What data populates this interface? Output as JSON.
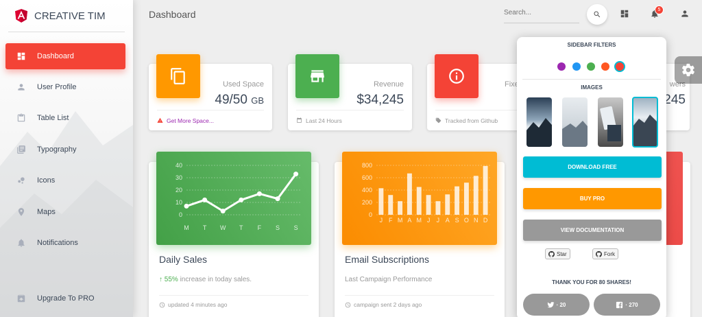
{
  "brand": {
    "name": "CREATIVE TIM"
  },
  "sidebar": {
    "items": [
      {
        "label": "Dashboard",
        "icon": "dashboard-icon"
      },
      {
        "label": "User Profile",
        "icon": "person-icon"
      },
      {
        "label": "Table List",
        "icon": "clipboard-icon"
      },
      {
        "label": "Typography",
        "icon": "library-books-icon"
      },
      {
        "label": "Icons",
        "icon": "bubble-chart-icon"
      },
      {
        "label": "Maps",
        "icon": "location-pin-icon"
      },
      {
        "label": "Notifications",
        "icon": "bell-icon"
      }
    ],
    "upgrade": "Upgrade To PRO"
  },
  "header": {
    "title": "Dashboard",
    "search_placeholder": "Search...",
    "notification_count": "5"
  },
  "stats": [
    {
      "category": "Used Space",
      "value": "49/50",
      "unit": "GB",
      "footer": "Get More Space...",
      "color": "#ff9800"
    },
    {
      "category": "Revenue",
      "value": "$34,245",
      "footer": "Last 24 Hours",
      "color": "#4caf50"
    },
    {
      "category": "Fixe",
      "value": "",
      "footer": "Tracked from Github",
      "color": "#f44336"
    },
    {
      "category": "wers",
      "value": "245",
      "footer": "",
      "color": "#00bcd4"
    }
  ],
  "charts": {
    "daily": {
      "title": "Daily Sales",
      "pct": "55%",
      "sub": " increase in today sales.",
      "footer": "updated 4 minutes ago"
    },
    "email": {
      "title": "Email Subscriptions",
      "sub": "Last Campaign Performance",
      "footer": "campaign sent 2 days ago"
    }
  },
  "chart_data": [
    {
      "type": "line",
      "categories": [
        "M",
        "T",
        "W",
        "T",
        "F",
        "S",
        "S"
      ],
      "values": [
        7,
        12,
        3,
        12,
        17,
        13,
        33
      ],
      "ylim": [
        0,
        40
      ],
      "yticks": [
        "40",
        "30",
        "20",
        "10",
        "0"
      ],
      "title": "",
      "xlabel": "",
      "ylabel": "",
      "color": "#4caf50",
      "grid": true
    },
    {
      "type": "bar",
      "categories": [
        "J",
        "F",
        "M",
        "A",
        "M",
        "J",
        "J",
        "A",
        "S",
        "O",
        "N",
        "D"
      ],
      "values": [
        430,
        320,
        220,
        670,
        450,
        320,
        220,
        330,
        460,
        520,
        630,
        790
      ],
      "ylim": [
        0,
        800
      ],
      "yticks": [
        "800",
        "600",
        "400",
        "200",
        "0"
      ],
      "title": "",
      "xlabel": "",
      "ylabel": "",
      "color": "#ff9800",
      "grid": true
    }
  ],
  "panel": {
    "filters_title": "SIDEBAR FILTERS",
    "filter_colors": [
      "#9c27b0",
      "#2196f3",
      "#4caf50",
      "#ff5722",
      "#f44336"
    ],
    "images_title": "IMAGES",
    "download": "DOWNLOAD FREE",
    "buy": "BUY PRO",
    "docs": "VIEW DOCUMENTATION",
    "star": "Star",
    "fork": "Fork",
    "thanks": "THANK YOU FOR 80 SHARES!",
    "twitter_count": "· 20",
    "facebook_count": "· 270"
  }
}
